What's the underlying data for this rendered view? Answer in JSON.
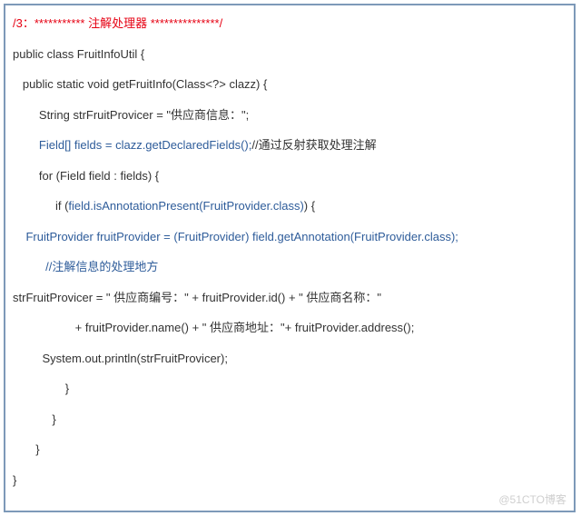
{
  "code": {
    "l1_red": "/3：*********** 注解处理器 ***************/",
    "l2": "public class FruitInfoUtil {",
    "l3": "   public static void getFruitInfo(Class<?> clazz) {",
    "l4": "        String strFruitProvicer = \"供应商信息：\";",
    "l5a": "        Field[] fields = clazz.getDeclaredFields();",
    "l5b": "//通过反射获取处理注解",
    "l6": "        for (Field field : fields) {",
    "l7a": "             if (",
    "l7b": "field.isAnnotationPresent(FruitProvider.class)",
    "l7c": ") {",
    "l8": "    FruitProvider fruitProvider = (FruitProvider) field.getAnnotation(FruitProvider.class);",
    "l9": "          //注解信息的处理地方",
    "l10": "strFruitProvicer = \" 供应商编号：\" + fruitProvider.id() + \" 供应商名称：\"",
    "l11": "                   + fruitProvider.name() + \" 供应商地址：\"+ fruitProvider.address();",
    "l12": "         System.out.println(strFruitProvicer);",
    "l13": "                }",
    "l14": "            }",
    "l15": "       }",
    "l16": "}"
  },
  "watermark": "@51CTO博客"
}
